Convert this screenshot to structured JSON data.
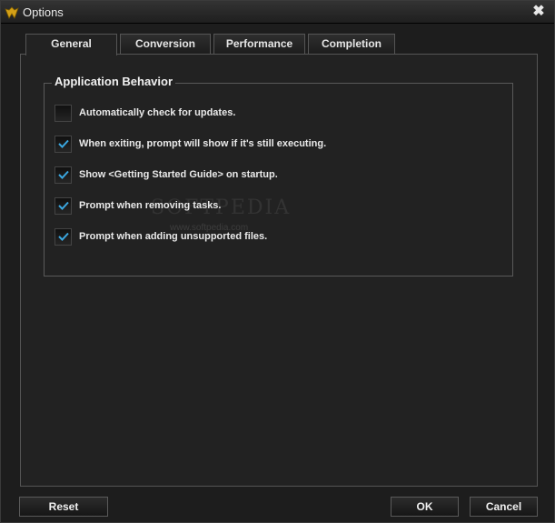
{
  "window": {
    "title": "Options",
    "close_glyph": "✖"
  },
  "tabs": [
    {
      "label": "General",
      "active": true
    },
    {
      "label": "Conversion",
      "active": false
    },
    {
      "label": "Performance",
      "active": false
    },
    {
      "label": "Completion",
      "active": false
    }
  ],
  "group": {
    "title": "Application Behavior"
  },
  "options": [
    {
      "label": "Automatically check for updates.",
      "checked": false
    },
    {
      "label": "When exiting, prompt will show if it's still executing.",
      "checked": true
    },
    {
      "label": "Show <Getting Started Guide> on startup.",
      "checked": true
    },
    {
      "label": "Prompt when removing tasks.",
      "checked": true
    },
    {
      "label": "Prompt when adding unsupported files.",
      "checked": true
    }
  ],
  "watermark": {
    "text": "SOFTPEDIA",
    "url": "www.softpedia.com"
  },
  "buttons": {
    "reset": "Reset",
    "ok": "OK",
    "cancel": "Cancel"
  },
  "colors": {
    "check_accent": "#3aa7e0",
    "logo_gold": "#d4a017"
  }
}
